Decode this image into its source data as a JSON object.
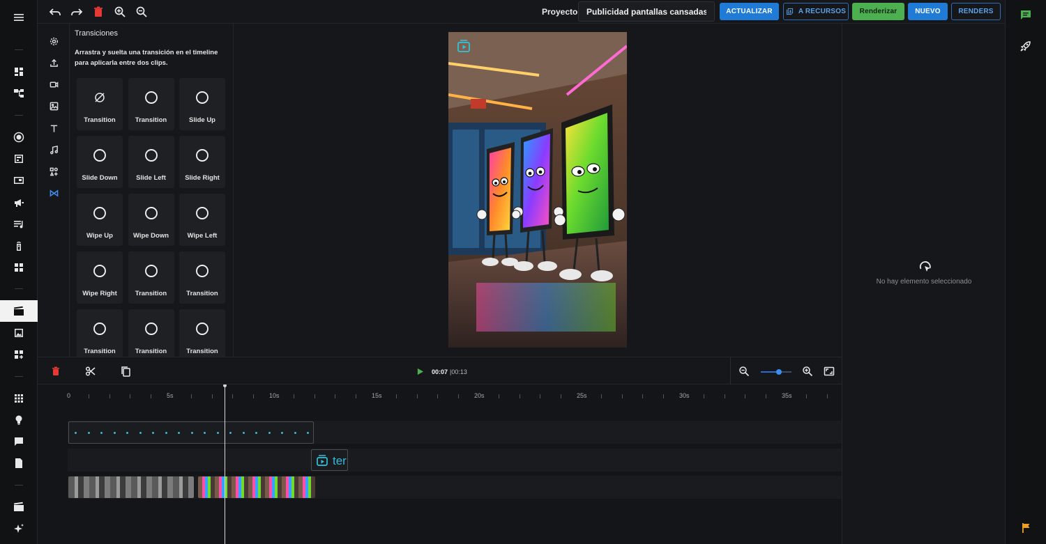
{
  "project": {
    "label": "Proyecto:",
    "name": "Publicidad pantallas cansadas"
  },
  "header_buttons": {
    "update": "ACTUALIZAR",
    "resources": "A RECURSOS",
    "render": "Renderizar",
    "new": "NUEVO",
    "renders": "RENDERS"
  },
  "transitions_panel": {
    "title": "Transiciones",
    "description": "Arrastra y suelta una transición en el timeline para aplicarla entre dos clips.",
    "items": [
      {
        "label": "Transition",
        "icon": "none-icon"
      },
      {
        "label": "Transition",
        "icon": "circle-icon"
      },
      {
        "label": "Slide Up",
        "icon": "circle-icon"
      },
      {
        "label": "Slide Down",
        "icon": "circle-icon"
      },
      {
        "label": "Slide Left",
        "icon": "circle-icon"
      },
      {
        "label": "Slide Right",
        "icon": "circle-icon"
      },
      {
        "label": "Wipe Up",
        "icon": "circle-icon"
      },
      {
        "label": "Wipe Down",
        "icon": "circle-icon"
      },
      {
        "label": "Wipe Left",
        "icon": "circle-icon"
      },
      {
        "label": "Wipe Right",
        "icon": "circle-icon"
      },
      {
        "label": "Transition",
        "icon": "circle-icon"
      },
      {
        "label": "Transition",
        "icon": "circle-icon"
      },
      {
        "label": "Transition",
        "icon": "circle-icon"
      },
      {
        "label": "Transition",
        "icon": "circle-icon"
      },
      {
        "label": "Transition",
        "icon": "circle-icon"
      }
    ]
  },
  "inspector": {
    "empty_text": "No hay elemento seleccionado"
  },
  "timeline": {
    "current_time": "00:07",
    "total_time": "|00:13",
    "ruler_labels": [
      "0",
      "5s",
      "10s",
      "15s",
      "20s",
      "25s",
      "30s",
      "35s"
    ],
    "text_clip_label": "ter",
    "zoom_level": 0.6
  },
  "colors": {
    "accent_blue": "#1f7bd6",
    "render_green": "#4caf50",
    "delete_red": "#e53935",
    "waveform_cyan": "#41b5d6"
  }
}
